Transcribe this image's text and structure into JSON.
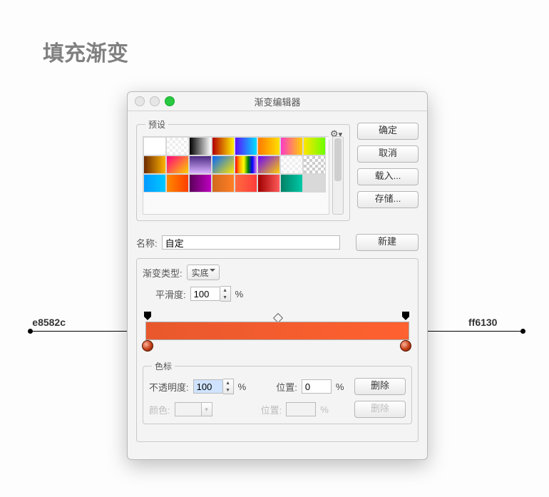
{
  "page_title": "填充渐变",
  "annotations": {
    "left": "e8582c",
    "right": "ff6130"
  },
  "window": {
    "title": "渐变编辑器"
  },
  "buttons": {
    "ok": "确定",
    "cancel": "取消",
    "load": "载入...",
    "save": "存储...",
    "new": "新建",
    "delete": "删除",
    "delete2": "删除"
  },
  "labels": {
    "presets": "预设",
    "name": "名称:",
    "grad_type": "渐变类型:",
    "smoothness": "平滑度:",
    "swatches": "色标",
    "opacity": "不透明度:",
    "position": "位置:",
    "color": "颜色:",
    "position2": "位置:",
    "percent": "%"
  },
  "values": {
    "name": "自定",
    "grad_type": "实底",
    "smoothness": "100",
    "opacity": "100",
    "position": "0",
    "position2": ""
  },
  "gradient": {
    "start": "#e8582c",
    "end": "#ff6130"
  },
  "preset_swatches": [
    "linear-gradient(90deg,#ffffff,#ffffff)",
    "repeating-conic-gradient(#eee 0 25%,#fff 0 50%) 0 0/8px 8px",
    "linear-gradient(90deg,#000,#fff)",
    "linear-gradient(90deg,#b30000,#ffef00)",
    "linear-gradient(90deg,#5a0fff,#00e0ff)",
    "linear-gradient(90deg,#ff7a00,#ffe000)",
    "linear-gradient(90deg,#ff3ac6,#ffd000)",
    "linear-gradient(90deg,#ffe600,#6bff00)",
    "linear-gradient(90deg,#6d2a00,#ffb300)",
    "linear-gradient(135deg,#ff0080,#ffd000)",
    "linear-gradient(180deg,#4a2a80,#d9b0ff)",
    "linear-gradient(135deg,#0066ff,#ffe600)",
    "linear-gradient(90deg,red,orange,yellow,green,blue,violet)",
    "linear-gradient(135deg,#6a00ff,#ffd000)",
    "repeating-conic-gradient(#eee 0 25%,#fff 0 50%) 0 0/8px 8px",
    "repeating-conic-gradient(#ccc 0 25%,#fff 0 50%) 0 0/8px 8px",
    "linear-gradient(90deg,#0099ff,#00c8ff)",
    "linear-gradient(90deg,#ff8a00,#ff3d00)",
    "linear-gradient(90deg,#5a005a,#c000c0)",
    "linear-gradient(90deg,#d2691e,#ff7f24)",
    "linear-gradient(90deg,#ff6a3d,#ff3d3d)",
    "linear-gradient(90deg,#a00000,#ff5a5a)",
    "linear-gradient(90deg,#008066,#00c9a7)",
    "linear-gradient(90deg,#d9d9d9,#d9d9d9)"
  ]
}
